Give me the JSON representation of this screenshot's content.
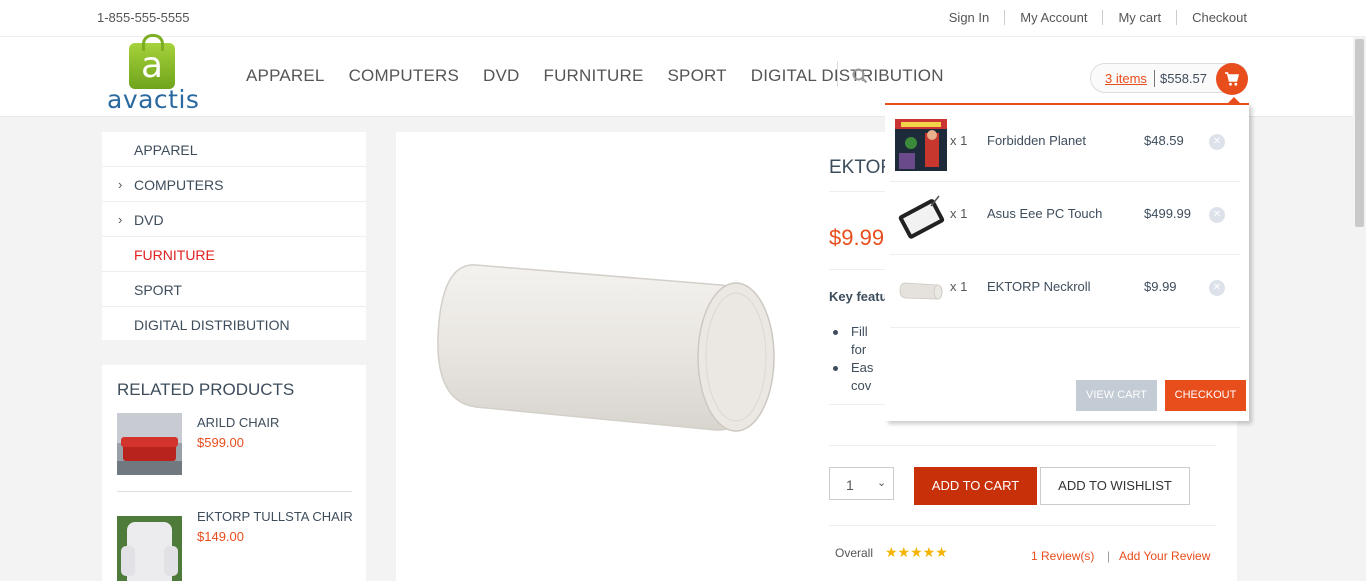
{
  "topbar": {
    "phone": "1-855-555-5555",
    "links": [
      "Sign In",
      "My Account",
      "My cart",
      "Checkout"
    ]
  },
  "header": {
    "logo_text": "avactis",
    "logo_letter": "a",
    "nav": [
      "APPAREL",
      "COMPUTERS",
      "DVD",
      "FURNITURE",
      "SPORT",
      "DIGITAL DISTRIBUTION"
    ],
    "cart_items": "3 items",
    "cart_total": "$558.57"
  },
  "sidebar": {
    "categories": [
      {
        "label": "APPAREL",
        "has_children": false
      },
      {
        "label": "COMPUTERS",
        "has_children": true
      },
      {
        "label": "DVD",
        "has_children": true
      },
      {
        "label": "FURNITURE",
        "has_children": false,
        "active": true
      },
      {
        "label": "SPORT",
        "has_children": false
      },
      {
        "label": "DIGITAL DISTRIBUTION",
        "has_children": false
      }
    ],
    "related_title": "RELATED PRODUCTS",
    "related": [
      {
        "name": "ARILD CHAIR",
        "price": "$599.00"
      },
      {
        "name": "EKTORP TULLSTA CHAIR",
        "price": "$149.00"
      }
    ]
  },
  "product": {
    "title": "EKTORP",
    "price": "$9.99",
    "key_features": "Key featu",
    "features": [
      [
        "Fill",
        "for"
      ],
      [
        "Eas",
        "cov"
      ]
    ],
    "qty": "1",
    "add_to_cart": "ADD TO CART",
    "add_to_wishlist": "ADD TO WISHLIST",
    "overall": "Overall",
    "stars": "★★★★★",
    "reviews": "1 Review(s)",
    "separator": "|",
    "add_review": "Add Your Review"
  },
  "cart_dropdown": {
    "items": [
      {
        "qty": "x 1",
        "name": "Forbidden Planet",
        "price": "$48.59"
      },
      {
        "qty": "x 1",
        "name": "Asus Eee PC Touch",
        "price": "$499.99"
      },
      {
        "qty": "x 1",
        "name": "EKTORP Neckroll",
        "price": "$9.99"
      }
    ],
    "view_cart": "VIEW CART",
    "checkout": "CHECKOUT"
  },
  "colors": {
    "accent": "#e84d1c",
    "add_to_cart": "#c8300a",
    "logo_green": "#8cc02a",
    "logo_blue": "#2a6aa0"
  }
}
